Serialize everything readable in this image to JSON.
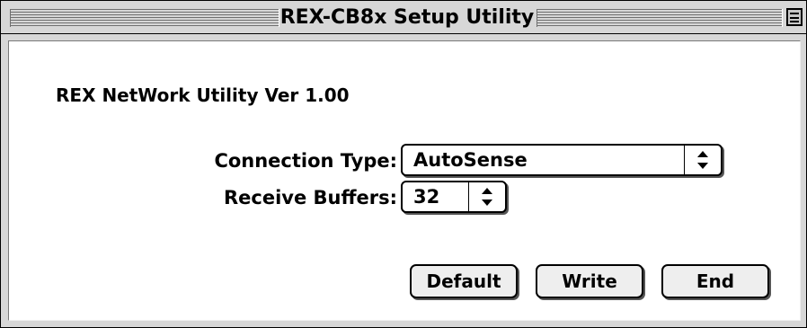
{
  "window": {
    "title": "REX-CB8x Setup Utility"
  },
  "content": {
    "heading": "REX NetWork Utility Ver 1.00",
    "connection_type": {
      "label": "Connection Type:",
      "value": "AutoSense"
    },
    "receive_buffers": {
      "label": "Receive Buffers:",
      "value": "32"
    }
  },
  "buttons": {
    "default_label": "Default",
    "write_label": "Write",
    "end_label": "End"
  },
  "icons": {
    "collapse": "collapse-box-icon",
    "popup_arrows": "updown-arrows-icon"
  }
}
